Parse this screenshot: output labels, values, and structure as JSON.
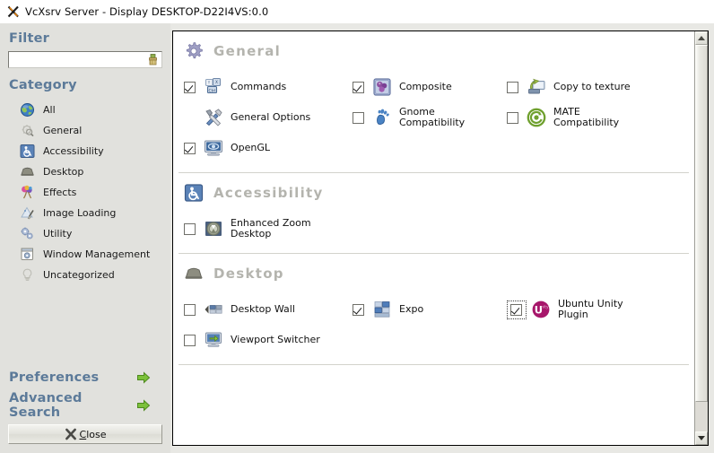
{
  "window": {
    "title": "VcXsrv Server - Display DESKTOP-D22I4VS:0.0",
    "logo_icon": "x-logo-icon"
  },
  "sidebar": {
    "filter_heading": "Filter",
    "filter_value": "",
    "filter_placeholder": "",
    "filter_clear_icon": "clear-broom-icon",
    "category_heading": "Category",
    "categories": [
      {
        "label": "All",
        "icon": "globe-icon"
      },
      {
        "label": "General",
        "icon": "gear-magnifier-icon"
      },
      {
        "label": "Accessibility",
        "icon": "wheelchair-icon"
      },
      {
        "label": "Desktop",
        "icon": "desk-icon"
      },
      {
        "label": "Effects",
        "icon": "fireworks-icon"
      },
      {
        "label": "Image Loading",
        "icon": "image-brush-icon"
      },
      {
        "label": "Utility",
        "icon": "gears-icon"
      },
      {
        "label": "Window Management",
        "icon": "window-gear-icon"
      },
      {
        "label": "Uncategorized",
        "icon": "lightbulb-icon"
      }
    ],
    "links": [
      {
        "label": "Preferences",
        "icon": "green-arrow-icon"
      },
      {
        "label": "Advanced Search",
        "icon": "green-arrow-icon"
      }
    ],
    "close_button": {
      "mnemonic": "C",
      "rest": "lose",
      "icon": "close-x-icon"
    }
  },
  "main": {
    "sections": [
      {
        "title": "General",
        "icon": "gear-icon",
        "plugins": [
          {
            "label": "Commands",
            "icon": "keyboard-keys-icon",
            "checkbox": "checked",
            "has_checkbox": true,
            "focused": false
          },
          {
            "label": "Composite",
            "icon": "composite-icon",
            "checkbox": "checked",
            "has_checkbox": true,
            "focused": false
          },
          {
            "label": "Copy to texture",
            "icon": "copy-texture-icon",
            "checkbox": "unchecked",
            "has_checkbox": true,
            "focused": false
          },
          {
            "label": "General Options",
            "icon": "tools-icon",
            "checkbox": "none",
            "has_checkbox": false,
            "focused": false
          },
          {
            "label": "Gnome\nCompatibility",
            "icon": "gnome-foot-icon",
            "checkbox": "unchecked",
            "has_checkbox": true,
            "focused": false
          },
          {
            "label": "MATE\nCompatibility",
            "icon": "mate-icon",
            "checkbox": "unchecked",
            "has_checkbox": true,
            "focused": false
          },
          {
            "label": "OpenGL",
            "icon": "monitor-opengl-icon",
            "checkbox": "checked",
            "has_checkbox": true,
            "focused": false
          }
        ]
      },
      {
        "title": "Accessibility",
        "icon": "wheelchair-icon",
        "plugins": [
          {
            "label": "Enhanced Zoom\nDesktop",
            "icon": "zoom-desktop-icon",
            "checkbox": "unchecked",
            "has_checkbox": true,
            "focused": false
          }
        ]
      },
      {
        "title": "Desktop",
        "icon": "desk-icon",
        "plugins": [
          {
            "label": "Desktop Wall",
            "icon": "desktop-wall-icon",
            "checkbox": "unchecked",
            "has_checkbox": true,
            "focused": false
          },
          {
            "label": "Expo",
            "icon": "expo-icon",
            "checkbox": "checked",
            "has_checkbox": true,
            "focused": false
          },
          {
            "label": "Ubuntu Unity\nPlugin",
            "icon": "unity-icon",
            "checkbox": "checked",
            "has_checkbox": true,
            "focused": true
          },
          {
            "label": "Viewport Switcher",
            "icon": "viewport-switcher-icon",
            "checkbox": "unchecked",
            "has_checkbox": true,
            "focused": false
          }
        ]
      }
    ]
  },
  "scrollbar": {
    "up_label": "scroll-up",
    "down_label": "scroll-down"
  },
  "colors": {
    "sidebar_bg": "#e1e1dd",
    "window_bg": "#e8e8e4",
    "heading_blue": "#5c7a99",
    "section_title_gray": "#b4b4ae",
    "content_bg": "#ffffff"
  }
}
